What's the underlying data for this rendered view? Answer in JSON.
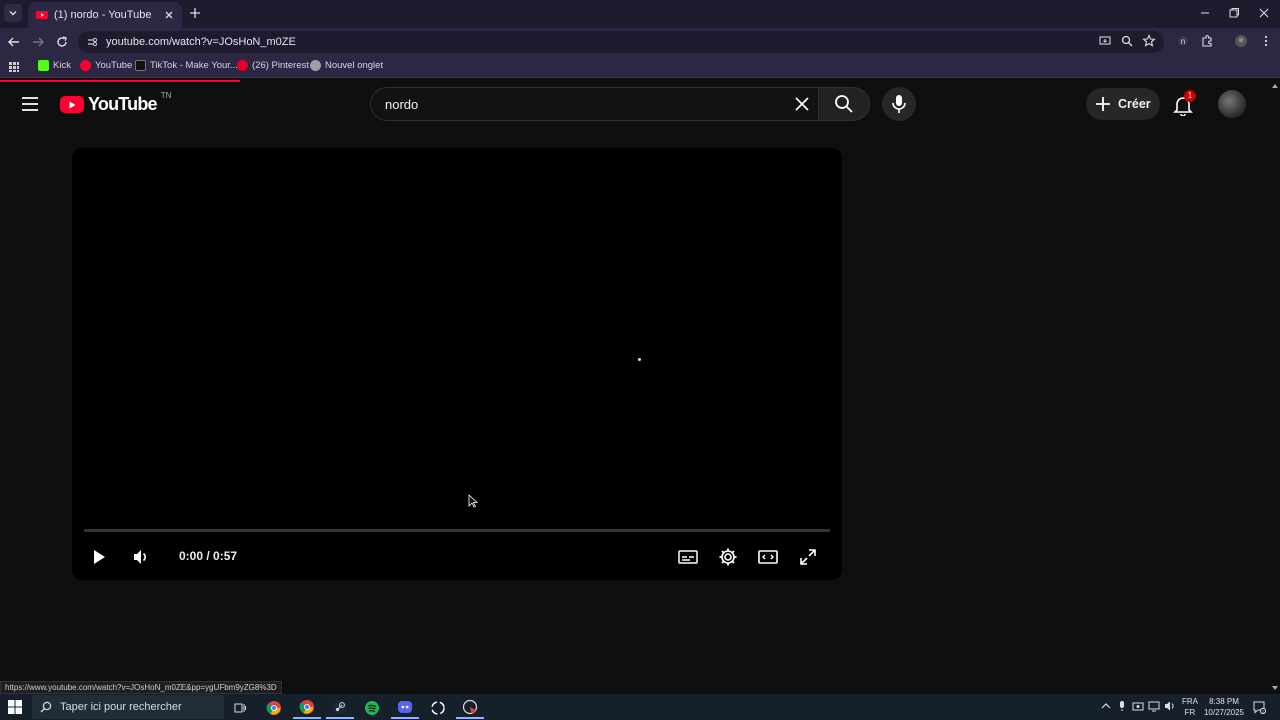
{
  "browser": {
    "tab": {
      "title": "(1) nordo - YouTube"
    },
    "address": {
      "url": "youtube.com/watch?v=JOsHoN_m0ZE"
    },
    "bookmarks": [
      {
        "label": "Kick",
        "color": "#53fc18"
      },
      {
        "label": "YouTube",
        "color": "#ff0033"
      },
      {
        "label": "TikTok - Make Your...",
        "color": "#ffffff"
      },
      {
        "label": "(26) Pinterest",
        "color": "#e60023"
      },
      {
        "label": "Nouvel onglet",
        "color": "#9aa0a6"
      }
    ],
    "status_url": "https://www.youtube.com/watch?v=JOsHoN_m0ZE&pp=ygUFbm9yZG8%3D"
  },
  "youtube": {
    "logo_text": "YouTube",
    "country_code": "TN",
    "search": {
      "query": "nordo"
    },
    "create_label": "Créer",
    "notification_count": "1",
    "player": {
      "time": "0:00 / 0:57",
      "progress": 0
    }
  },
  "taskbar": {
    "search_placeholder": "Taper ici pour rechercher",
    "lang_top": "FRA",
    "lang_bottom": "FR",
    "time": "8:38 PM",
    "date": "10/27/2025"
  },
  "colors": {
    "accent": "#ff0033",
    "browser_frame": "#1f1b2e",
    "browser_toolbar": "#2c2742",
    "page_bg": "#0f0f0f"
  }
}
